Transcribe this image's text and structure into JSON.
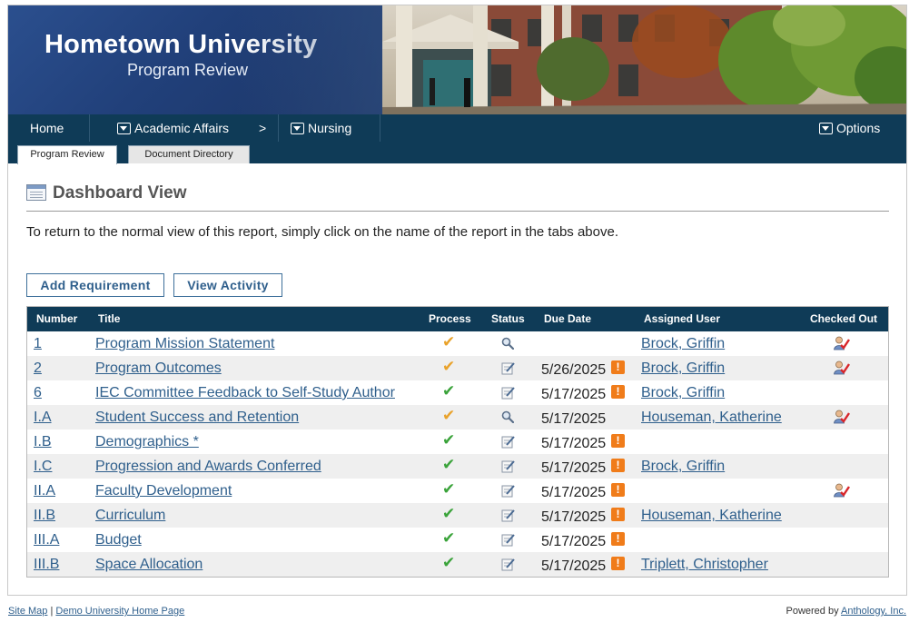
{
  "banner": {
    "university": "Hometown University",
    "subtitle": "Program Review"
  },
  "nav": {
    "home": "Home",
    "academic_affairs": "Academic Affairs",
    "separator": ">",
    "nursing": "Nursing",
    "options": "Options"
  },
  "tabs": [
    {
      "label": "Program Review",
      "active": true
    },
    {
      "label": "Document Directory",
      "active": false
    }
  ],
  "page": {
    "title": "Dashboard View",
    "intro": "To return to the normal view of this report, simply click on the name of the report in the tabs above."
  },
  "buttons": {
    "add_requirement": "Add Requirement",
    "view_activity": "View Activity"
  },
  "table": {
    "headers": {
      "number": "Number",
      "title": "Title",
      "process": "Process",
      "status": "Status",
      "due_date": "Due Date",
      "assigned_user": "Assigned User",
      "checked_out": "Checked Out"
    },
    "rows": [
      {
        "number": "1",
        "title": "Program Mission Statement",
        "process": "partial",
        "status": "review-icon",
        "due": "",
        "warn": false,
        "user": "Brock, Griffin",
        "checked_out": true
      },
      {
        "number": "2",
        "title": "Program Outcomes",
        "process": "partial",
        "status": "edit-icon",
        "due": "5/26/2025",
        "warn": true,
        "user": "Brock, Griffin",
        "checked_out": true
      },
      {
        "number": "6",
        "title": "IEC Committee Feedback to Self-Study Author",
        "process": "complete",
        "status": "edit-icon",
        "due": "5/17/2025",
        "warn": true,
        "user": "Brock, Griffin",
        "checked_out": false
      },
      {
        "number": "I.A",
        "title": "Student Success and Retention",
        "process": "partial",
        "status": "review-icon",
        "due": "5/17/2025",
        "warn": false,
        "user": "Houseman, Katherine",
        "checked_out": true
      },
      {
        "number": "I.B",
        "title": "Demographics *",
        "process": "complete",
        "status": "edit-icon",
        "due": "5/17/2025",
        "warn": true,
        "user": "",
        "checked_out": false
      },
      {
        "number": "I.C",
        "title": "Progression and Awards Conferred",
        "process": "complete",
        "status": "edit-icon",
        "due": "5/17/2025",
        "warn": true,
        "user": "Brock, Griffin",
        "checked_out": false
      },
      {
        "number": "II.A",
        "title": "Faculty Development",
        "process": "complete",
        "status": "edit-icon",
        "due": "5/17/2025",
        "warn": true,
        "user": "",
        "checked_out": true
      },
      {
        "number": "II.B",
        "title": "Curriculum",
        "process": "complete",
        "status": "edit-icon",
        "due": "5/17/2025",
        "warn": true,
        "user": "Houseman, Katherine",
        "checked_out": false
      },
      {
        "number": "III.A",
        "title": "Budget",
        "process": "complete",
        "status": "edit-icon",
        "due": "5/17/2025",
        "warn": true,
        "user": "",
        "checked_out": false
      },
      {
        "number": "III.B",
        "title": "Space Allocation",
        "process": "complete",
        "status": "edit-icon",
        "due": "5/17/2025",
        "warn": true,
        "user": "Triplett, Christopher",
        "checked_out": false
      }
    ]
  },
  "footer": {
    "site_map": "Site Map",
    "divider": "|",
    "home_page": "Demo University Home Page",
    "powered_by": "Powered by",
    "vendor": "Anthology, Inc."
  },
  "icons": {
    "checkmark": "✔",
    "warning": "!"
  },
  "colors": {
    "navbar": "#0f3b57",
    "link": "#2f5f8c",
    "check_complete": "#3aa33a",
    "check_partial": "#e9a22a",
    "warning": "#f07c1a"
  }
}
